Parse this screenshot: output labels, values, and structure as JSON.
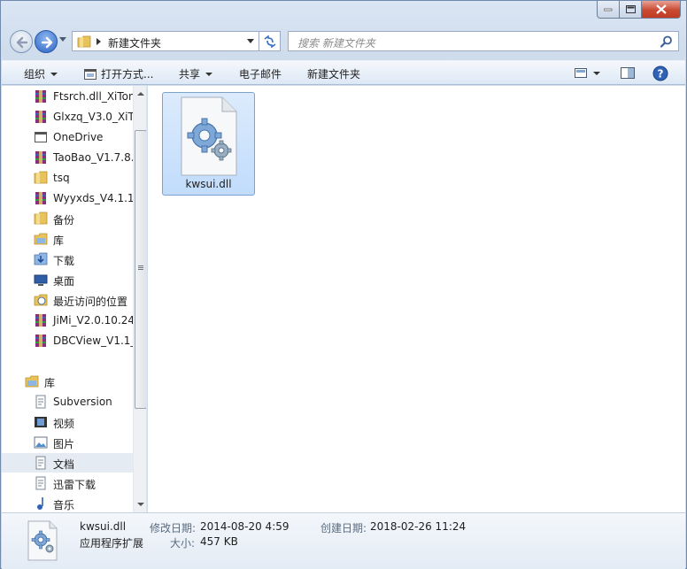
{
  "window": {
    "address": {
      "path": "新建文件夹"
    },
    "search": {
      "placeholder": "搜索 新建文件夹"
    }
  },
  "toolbar": {
    "organize": "组织",
    "open_with": "打开方式...",
    "share": "共享",
    "email": "电子邮件",
    "new_folder": "新建文件夹"
  },
  "sidebar": {
    "items": [
      {
        "label": "Ftsrch.dll_XiTon",
        "icon": "winrar-archive-icon"
      },
      {
        "label": "Glxzq_V3.0_XiTo",
        "icon": "winrar-archive-icon"
      },
      {
        "label": "OneDrive",
        "icon": "onedrive-window-icon"
      },
      {
        "label": "TaoBao_V1.7.8.",
        "icon": "winrar-archive-icon"
      },
      {
        "label": "tsq",
        "icon": "folder-icon"
      },
      {
        "label": "Wyyxds_V4.1.1.",
        "icon": "winrar-archive-icon"
      },
      {
        "label": "备份",
        "icon": "folder-icon"
      },
      {
        "label": "库",
        "icon": "library-icon"
      },
      {
        "label": "下载",
        "icon": "downloads-icon"
      },
      {
        "label": "桌面",
        "icon": "desktop-icon"
      },
      {
        "label": "最近访问的位置",
        "icon": "recent-places-icon"
      },
      {
        "label": "JiMi_V2.0.10.24_",
        "icon": "winrar-archive-icon"
      },
      {
        "label": "DBCView_V1.1_",
        "icon": "winrar-archive-icon"
      }
    ],
    "libraries": {
      "header": "库",
      "items": [
        {
          "label": "Subversion",
          "icon": "document-library-icon"
        },
        {
          "label": "视频",
          "icon": "video-library-icon"
        },
        {
          "label": "图片",
          "icon": "picture-library-icon"
        },
        {
          "label": "文档",
          "icon": "document-library-icon",
          "selected": true
        },
        {
          "label": "迅雷下载",
          "icon": "document-library-icon"
        },
        {
          "label": "音乐",
          "icon": "music-library-icon"
        }
      ]
    }
  },
  "files": [
    {
      "name": "kwsui.dll",
      "icon": "dll-file-icon",
      "selected": true
    }
  ],
  "details": {
    "name": "kwsui.dll",
    "type": "应用程序扩展",
    "modified_label": "修改日期:",
    "modified_value": "2014-08-20 4:59",
    "size_label": "大小:",
    "size_value": "457 KB",
    "created_label": "创建日期:",
    "created_value": "2018-02-26 11:24"
  },
  "colors": {
    "selection": "#c1dcfc",
    "close_button": "#c94a32",
    "accent": "#2c63c4"
  }
}
